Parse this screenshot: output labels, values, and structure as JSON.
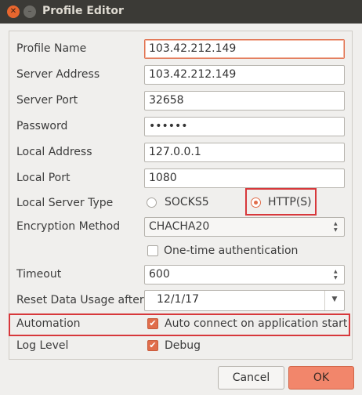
{
  "window": {
    "title": "Profile Editor",
    "close_glyph": "✕",
    "minimize_glyph": "–"
  },
  "form": {
    "profile_name": {
      "label": "Profile Name",
      "value": "103.42.212.149"
    },
    "server_address": {
      "label": "Server Address",
      "value": "103.42.212.149"
    },
    "server_port": {
      "label": "Server Port",
      "value": "32658"
    },
    "password": {
      "label": "Password",
      "value": "••••••"
    },
    "local_address": {
      "label": "Local Address",
      "value": "127.0.0.1"
    },
    "local_port": {
      "label": "Local Port",
      "value": "1080"
    },
    "local_server_type": {
      "label": "Local Server Type",
      "options": [
        "SOCKS5",
        "HTTP(S)"
      ],
      "selected": "HTTP(S)"
    },
    "encryption_method": {
      "label": "Encryption Method",
      "value": "CHACHA20"
    },
    "one_time_auth": {
      "label": "One-time authentication",
      "checked": false
    },
    "timeout": {
      "label": "Timeout",
      "value": "600"
    },
    "reset_usage": {
      "label": "Reset Data Usage after",
      "value": "12/1/17"
    },
    "automation": {
      "label": "Automation",
      "checkbox_label": "Auto connect on application start",
      "checked": true
    },
    "log_level": {
      "label": "Log Level",
      "checkbox_label": "Debug",
      "checked": true
    }
  },
  "buttons": {
    "cancel": "Cancel",
    "ok": "OK"
  },
  "icons": {
    "check": "✔",
    "spin": "▲▼",
    "dropdown": "▼"
  },
  "colors": {
    "accent": "#e06d4b",
    "highlight": "#d7383b",
    "titlebar": "#3b3a36"
  }
}
